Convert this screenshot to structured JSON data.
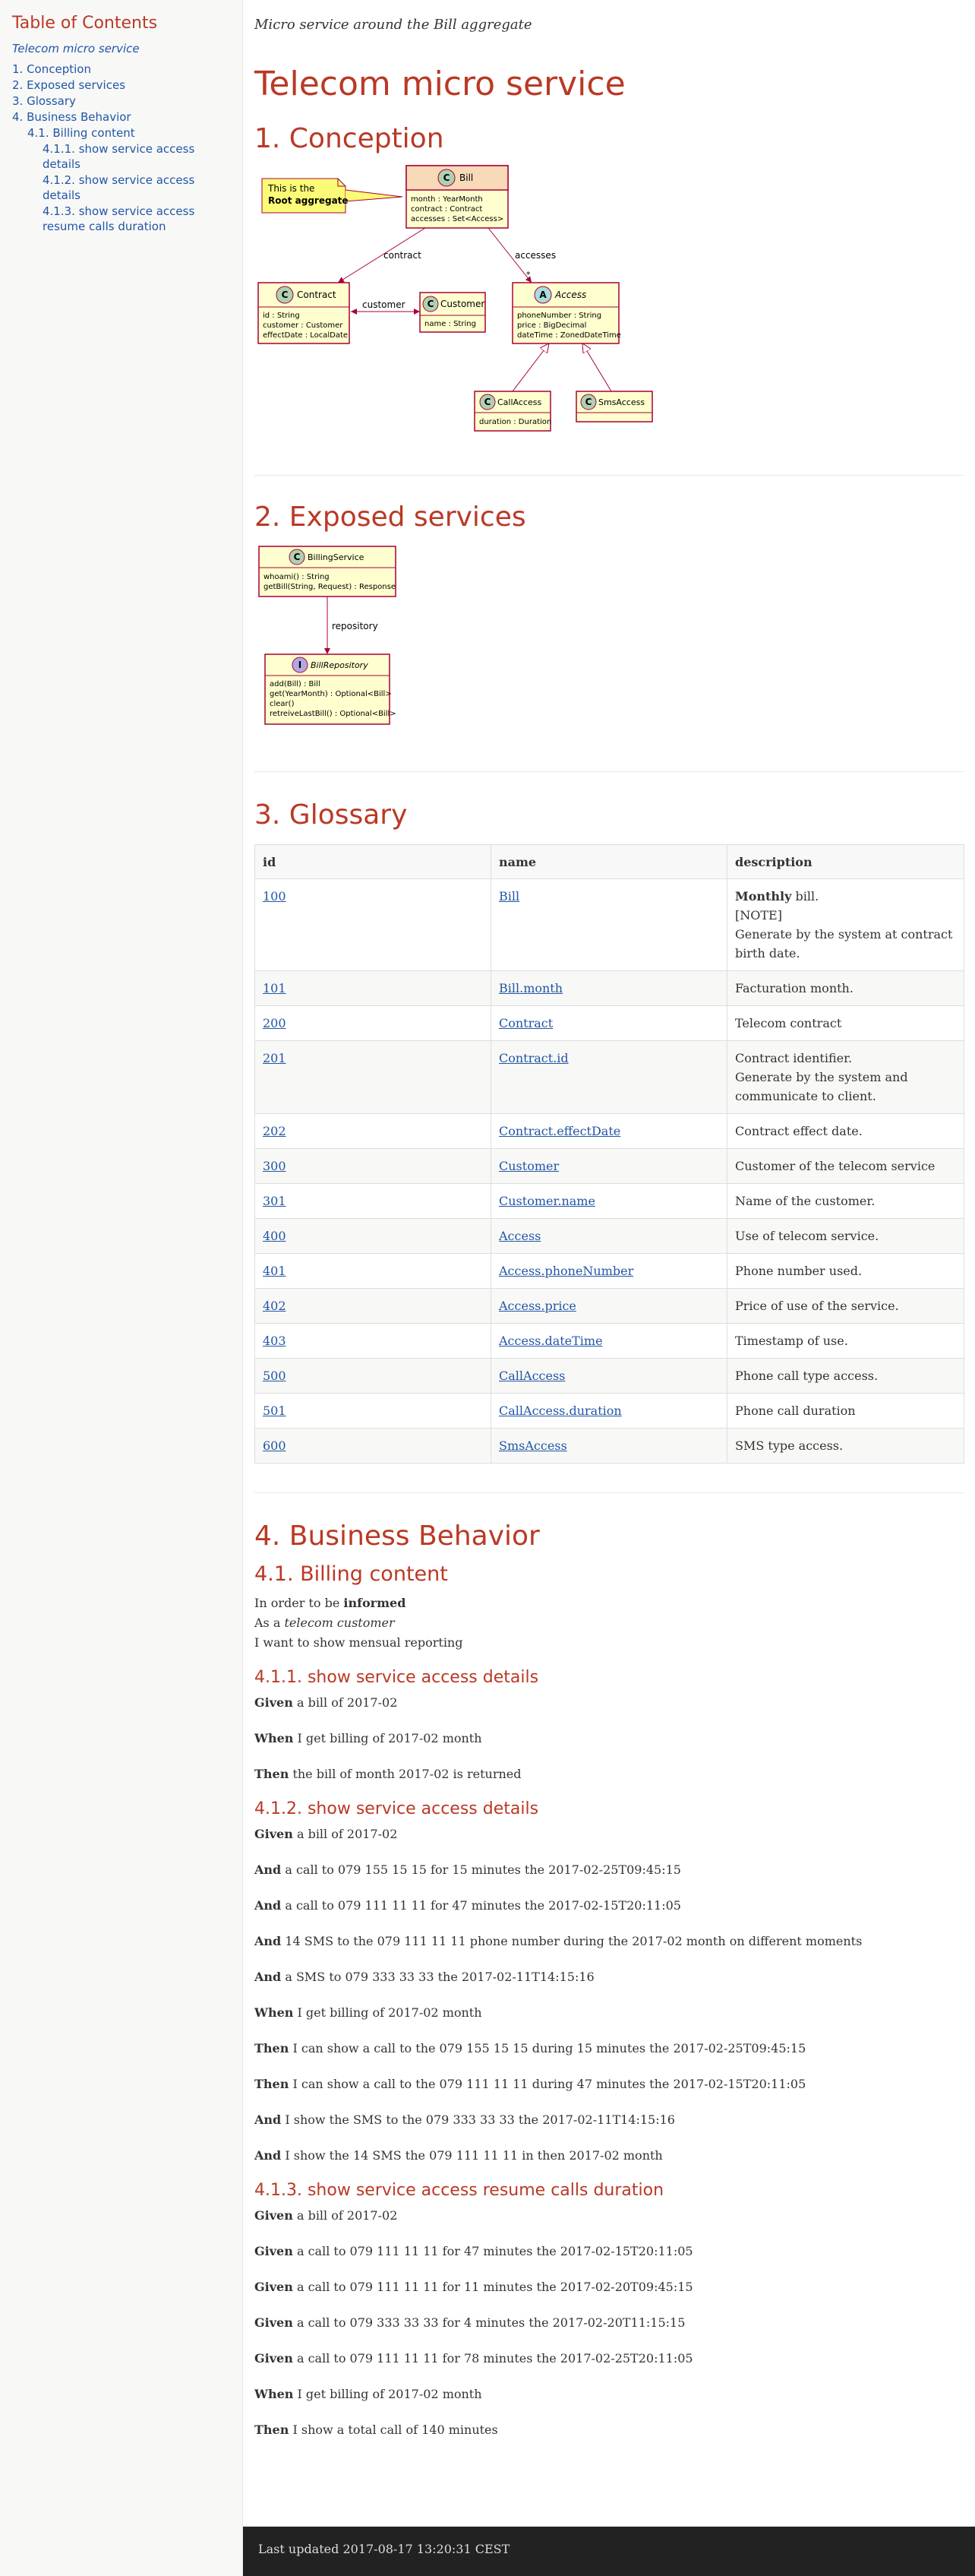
{
  "toc": {
    "title": "Table of Contents",
    "subtitle": "Telecom micro service",
    "items": [
      {
        "label": "1. Conception",
        "level": 1
      },
      {
        "label": "2. Exposed services",
        "level": 1
      },
      {
        "label": "3. Glossary",
        "level": 1
      },
      {
        "label": "4. Business Behavior",
        "level": 1
      },
      {
        "label": "4.1. Billing content",
        "level": 2
      },
      {
        "label": "4.1.1. show service access details",
        "level": 3
      },
      {
        "label": "4.1.2. show service access details",
        "level": 3
      },
      {
        "label": "4.1.3. show service access resume calls duration",
        "level": 3
      }
    ]
  },
  "header": {
    "subtitle": "Micro service around the Bill aggregate",
    "title": "Telecom micro service"
  },
  "conception": {
    "heading": "1. Conception",
    "diagram": {
      "note": [
        "This is the",
        "Root aggregate"
      ],
      "bill": {
        "name": "Bill",
        "stereo": "C",
        "fields": [
          "month : YearMonth",
          "contract : Contract",
          "accesses : Set<Access>"
        ]
      },
      "contract": {
        "name": "Contract",
        "stereo": "C",
        "fields": [
          "id : String",
          "customer : Customer",
          "effectDate : LocalDate"
        ]
      },
      "customer": {
        "name": "Customer",
        "stereo": "C",
        "fields": [
          "name : String"
        ]
      },
      "access": {
        "name": "Access",
        "stereo": "A",
        "fields": [
          "phoneNumber : String",
          "price : BigDecimal",
          "dateTime : ZonedDateTime"
        ]
      },
      "callaccess": {
        "name": "CallAccess",
        "stereo": "C",
        "fields": [
          "duration : Duration"
        ]
      },
      "smsaccess": {
        "name": "SmsAccess",
        "stereo": "C",
        "fields": []
      },
      "rel_contract": "contract",
      "rel_customer": "customer",
      "rel_accesses": "accesses",
      "rel_star": "*"
    }
  },
  "services": {
    "heading": "2. Exposed services",
    "diagram": {
      "billingservice": {
        "name": "BillingService",
        "stereo": "C",
        "fields": [
          "whoami() : String",
          "getBill(String, Request) : Response"
        ]
      },
      "billrepository": {
        "name": "BillRepository",
        "stereo": "I",
        "fields": [
          "add(Bill) : Bill",
          "get(YearMonth) : Optional<Bill>",
          "clear()",
          "retreiveLastBill() : Optional<Bill>"
        ]
      },
      "rel_repository": "repository"
    }
  },
  "glossary": {
    "heading": "3. Glossary",
    "columns": [
      "id",
      "name",
      "description"
    ],
    "rows": [
      {
        "id": "100",
        "name": "Bill",
        "desc": [
          {
            "b": "Monthly",
            "t": " bill."
          },
          {
            "t": "[NOTE]"
          },
          {
            "t": "Generate by the system at contract birth date."
          }
        ]
      },
      {
        "id": "101",
        "name": "Bill.month",
        "desc": [
          {
            "t": "Facturation month."
          }
        ]
      },
      {
        "id": "200",
        "name": "Contract",
        "desc": [
          {
            "t": "Telecom contract"
          }
        ]
      },
      {
        "id": "201",
        "name": "Contract.id",
        "desc": [
          {
            "t": "Contract identifier."
          },
          {
            "t": "Generate by the system and communicate to client."
          }
        ]
      },
      {
        "id": "202",
        "name": "Contract.effectDate",
        "desc": [
          {
            "t": "Contract effect date."
          }
        ]
      },
      {
        "id": "300",
        "name": "Customer",
        "desc": [
          {
            "t": "Customer of the telecom service"
          }
        ]
      },
      {
        "id": "301",
        "name": "Customer.name",
        "desc": [
          {
            "t": "Name of the customer."
          }
        ]
      },
      {
        "id": "400",
        "name": "Access",
        "desc": [
          {
            "t": "Use of telecom service."
          }
        ]
      },
      {
        "id": "401",
        "name": "Access.phoneNumber",
        "desc": [
          {
            "t": "Phone number used."
          }
        ]
      },
      {
        "id": "402",
        "name": "Access.price",
        "desc": [
          {
            "t": "Price of use of the service."
          }
        ]
      },
      {
        "id": "403",
        "name": "Access.dateTime",
        "desc": [
          {
            "t": "Timestamp of use."
          }
        ]
      },
      {
        "id": "500",
        "name": "CallAccess",
        "desc": [
          {
            "t": "Phone call type access."
          }
        ]
      },
      {
        "id": "501",
        "name": "CallAccess.duration",
        "desc": [
          {
            "t": "Phone call duration"
          }
        ]
      },
      {
        "id": "600",
        "name": "SmsAccess",
        "desc": [
          {
            "t": "SMS type access."
          }
        ]
      }
    ]
  },
  "behavior": {
    "heading": "4. Business Behavior",
    "billing_heading": "4.1. Billing content",
    "intro": [
      {
        "pre": "In order to be ",
        "b": "informed",
        "i": "",
        "post": ""
      },
      {
        "pre": "As a ",
        "b": "",
        "i": "telecom customer",
        "post": ""
      },
      {
        "pre": "I want to show mensual reporting",
        "b": "",
        "i": "",
        "post": ""
      }
    ],
    "scenarios": [
      {
        "heading": "4.1.1. show service access details",
        "steps": [
          {
            "kw": "Given",
            "text": " a bill of 2017-02"
          },
          {
            "kw": "When",
            "text": " I get billing of 2017-02 month"
          },
          {
            "kw": "Then",
            "text": " the bill of month 2017-02 is returned"
          }
        ]
      },
      {
        "heading": "4.1.2. show service access details",
        "steps": [
          {
            "kw": "Given",
            "text": " a bill of 2017-02"
          },
          {
            "kw": "And",
            "text": " a call to 079 155 15 15 for 15 minutes the 2017-02-25T09:45:15"
          },
          {
            "kw": "And",
            "text": " a call to 079 111 11 11 for 47 minutes the 2017-02-15T20:11:05"
          },
          {
            "kw": "And",
            "text": " 14 SMS to the 079 111 11 11 phone number during the 2017-02 month on different moments"
          },
          {
            "kw": "And",
            "text": " a SMS to 079 333 33 33 the 2017-02-11T14:15:16"
          },
          {
            "kw": "When",
            "text": " I get billing of 2017-02 month"
          },
          {
            "kw": "Then",
            "text": " I can show a call to the 079 155 15 15 during 15 minutes the 2017-02-25T09:45:15"
          },
          {
            "kw": "Then",
            "text": " I can show a call to the 079 111 11 11 during 47 minutes the 2017-02-15T20:11:05"
          },
          {
            "kw": "And",
            "text": " I show the SMS to the 079 333 33 33 the 2017-02-11T14:15:16"
          },
          {
            "kw": "And",
            "text": " I show the 14 SMS the 079 111 11 11 in then 2017-02 month"
          }
        ]
      },
      {
        "heading": "4.1.3. show service access resume calls duration",
        "steps": [
          {
            "kw": "Given",
            "text": " a bill of 2017-02"
          },
          {
            "kw": "Given",
            "text": " a call to 079 111 11 11 for 47 minutes the 2017-02-15T20:11:05"
          },
          {
            "kw": "Given",
            "text": " a call to 079 111 11 11 for 11 minutes the 2017-02-20T09:45:15"
          },
          {
            "kw": "Given",
            "text": " a call to 079 333 33 33 for 4 minutes the 2017-02-20T11:15:15"
          },
          {
            "kw": "Given",
            "text": " a call to 079 111 11 11 for 78 minutes the 2017-02-25T20:11:05"
          },
          {
            "kw": "When",
            "text": " I get billing of 2017-02 month"
          },
          {
            "kw": "Then",
            "text": " I show a total call of 140 minutes"
          }
        ]
      }
    ]
  },
  "footer": {
    "text": "Last updated 2017-08-17 13:20:31 CEST"
  },
  "colors": {
    "heading": "#ba3925",
    "link": "#2156a5",
    "uml_fill": "#fefece",
    "uml_border": "#a80036",
    "note_fill": "#fbfb77"
  }
}
